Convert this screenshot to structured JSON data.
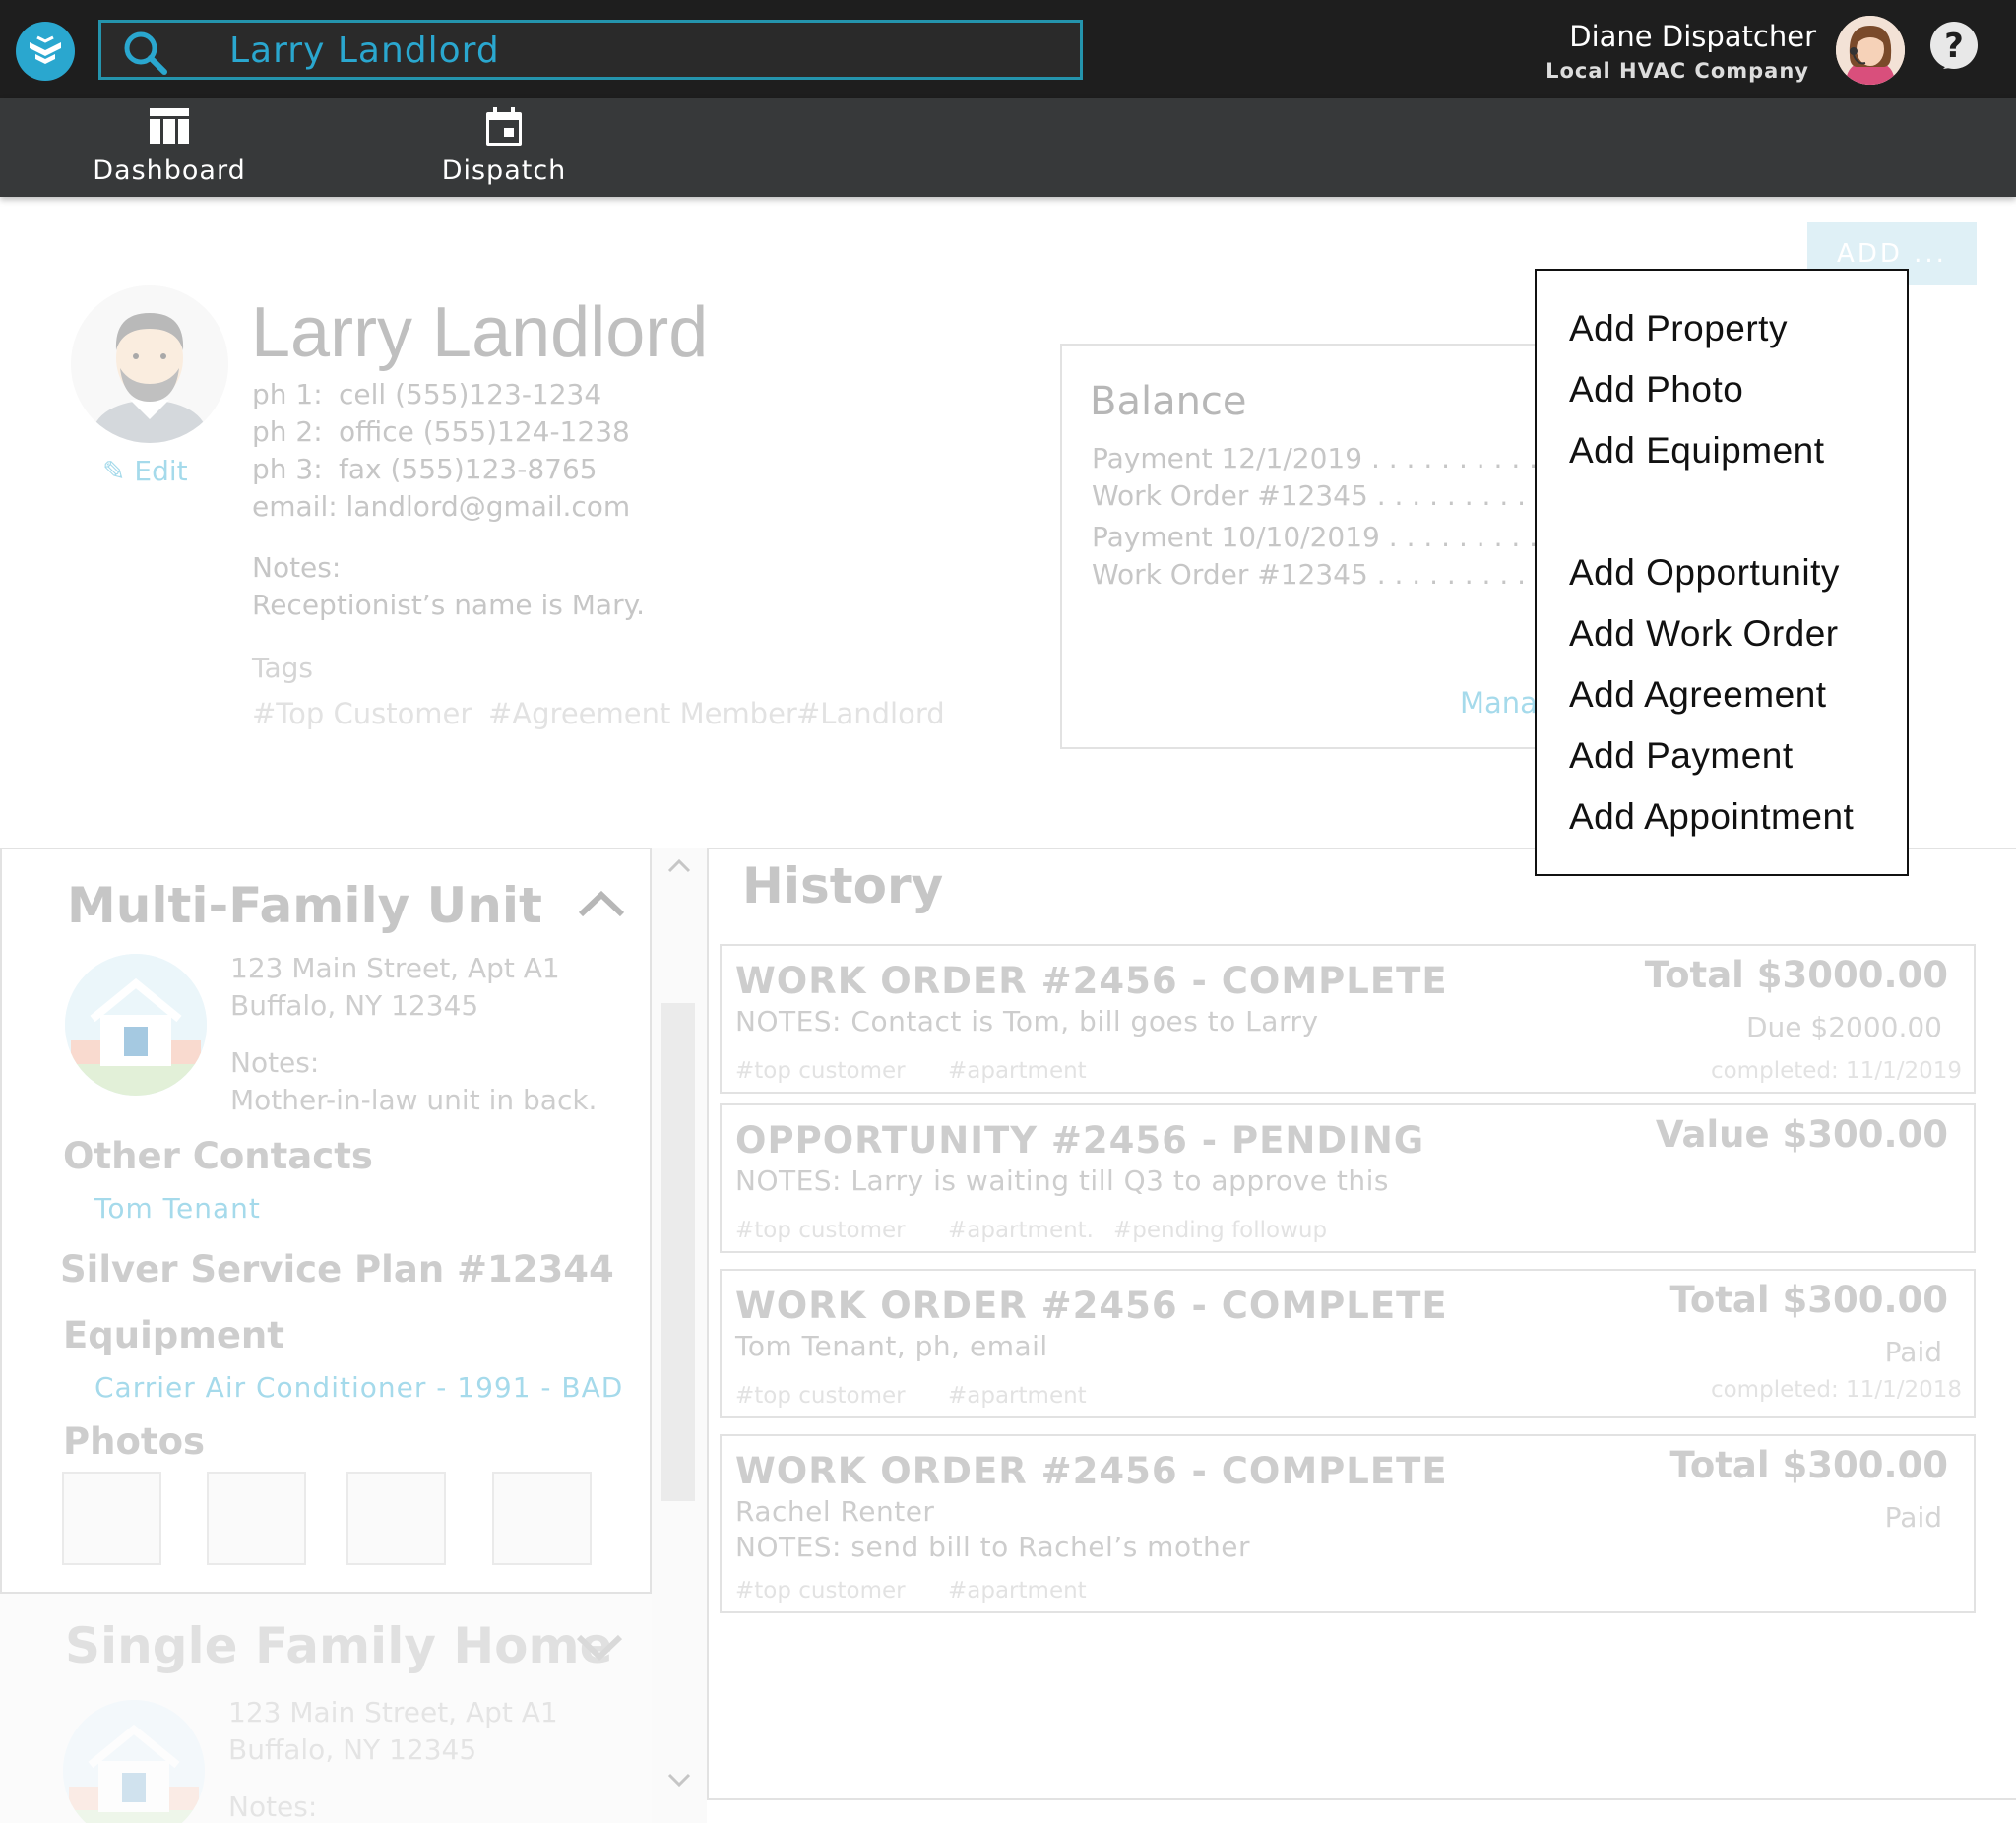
{
  "topbar": {
    "search_value": "Larry Landlord",
    "user_name": "Diane Dispatcher",
    "user_company": "Local HVAC Company",
    "brand_color": "#2aa7cf"
  },
  "nav": {
    "items": [
      {
        "label": "Dashboard",
        "icon": "dashboard-icon"
      },
      {
        "label": "Dispatch",
        "icon": "calendar-icon"
      }
    ]
  },
  "actions": {
    "add_label": "ADD ...",
    "menu": [
      "Add Property",
      "Add Photo",
      "Add Equipment",
      "Add Opportunity",
      "Add Work Order",
      "Add Agreement",
      "Add Payment",
      "Add Appointment"
    ]
  },
  "customer": {
    "name": "Larry Landlord",
    "edit_label": "Edit",
    "phones": [
      {
        "key": "ph 1:",
        "value": "cell (555)123-1234"
      },
      {
        "key": "ph 2:",
        "value": "office (555)124-1238"
      },
      {
        "key": "ph 3:",
        "value": "fax (555)123-8765"
      }
    ],
    "email": "email: landlord@gmail.com",
    "notes_label": "Notes:",
    "notes": "Receptionist’s name is Mary.",
    "tags_label": "Tags",
    "tags": [
      "#Top Customer",
      "#Agreement Member",
      "#Landlord"
    ]
  },
  "balance": {
    "title": "Balance",
    "rows": [
      "Payment 12/1/2019 . . . . . . . . . . .",
      "Work Order #12345 . . . . . . . . . . .",
      "Payment 10/10/2019 . . . . . . . . . .",
      "Work Order #12345 . . . . . . . . . . ."
    ],
    "manage_label": "Mana"
  },
  "property": {
    "title": "Multi-Family Unit",
    "address1": "123 Main Street, Apt A1",
    "address2": "Buffalo, NY 12345",
    "notes_label": "Notes:",
    "notes": "Mother-in-law unit in back.",
    "other_contacts_label": "Other Contacts",
    "contact": "Tom Tenant",
    "plan": "Silver Service Plan #12344",
    "equipment_label": "Equipment",
    "equipment": "Carrier Air Conditioner - 1991 - BAD",
    "photos_label": "Photos"
  },
  "property2": {
    "title": "Single Family Home",
    "address1": "123 Main Street, Apt A1",
    "address2": "Buffalo, NY 12345",
    "notes_label": "Notes:"
  },
  "history": {
    "title": "History",
    "cards": [
      {
        "title": "WORK ORDER #2456 - COMPLETE",
        "lines": [
          "NOTES: Contact is Tom, bill goes to Larry"
        ],
        "tags": [
          "#top customer",
          "#apartment"
        ],
        "amount": "Total $3000.00",
        "sub": "Due $2000.00",
        "date": "completed: 11/1/2019"
      },
      {
        "title": "OPPORTUNITY #2456 - PENDING",
        "lines": [
          "NOTES: Larry is waiting till Q3 to approve this"
        ],
        "tags": [
          "#top customer",
          "#apartment.",
          "#pending followup"
        ],
        "amount": "Value $300.00"
      },
      {
        "title": "WORK ORDER #2456 - COMPLETE",
        "lines": [
          "Tom Tenant, ph, email"
        ],
        "tags": [
          "#top customer",
          "#apartment"
        ],
        "amount": "Total $300.00",
        "sub": "Paid",
        "date": "completed: 11/1/2018"
      },
      {
        "title": "WORK ORDER #2456 - COMPLETE",
        "lines": [
          "Rachel Renter",
          "NOTES: send bill to Rachel’s mother"
        ],
        "tags": [
          "#top customer",
          "#apartment"
        ],
        "amount": "Total $300.00",
        "sub": "Paid"
      }
    ]
  }
}
